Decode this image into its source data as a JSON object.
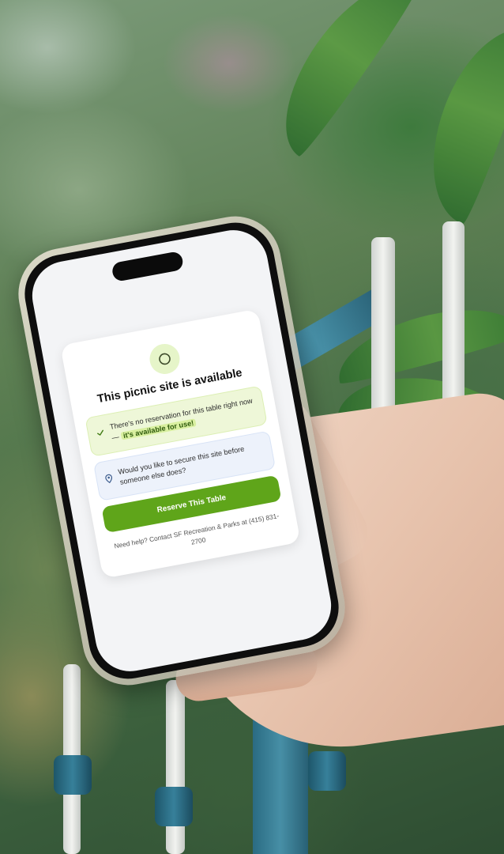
{
  "card": {
    "title": "This picnic site is available",
    "status_icon": "circle-icon",
    "notice_available": {
      "icon": "check-icon",
      "text": "There's no reservation for this table right now —",
      "highlight": "it's available for use!"
    },
    "notice_reserve": {
      "icon": "location-pin-icon",
      "text": "Would you like to secure this site before someone else does?"
    },
    "reserve_button_label": "Reserve This Table",
    "help_text": "Need help? Contact SF Recreation & Parks at (415) 831-2700"
  },
  "colors": {
    "accent": "#5fa51a",
    "success_bg": "#eef7d8",
    "highlight_bg": "#d8ef9f",
    "info_bg": "#edf2fb",
    "screen_bg": "#f3f4f6"
  }
}
